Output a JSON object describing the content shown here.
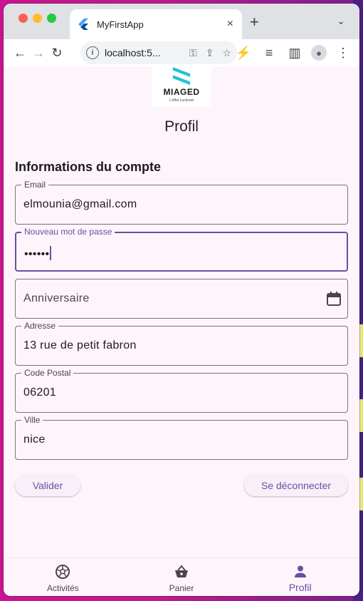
{
  "browser": {
    "tab_title": "MyFirstApp",
    "tab_close": "×",
    "new_tab": "+",
    "tab_menu": "⌄",
    "url": "localhost:5..."
  },
  "app": {
    "logo_text": "MIAGED",
    "logo_sub": "L'effet Lucknow",
    "page_title": "Profil",
    "section_title": "Informations du compte"
  },
  "form": {
    "email": {
      "label": "Email",
      "value": "elmounia@gmail.com"
    },
    "password": {
      "label": "Nouveau mot de passe",
      "value": "••••••"
    },
    "birthday": {
      "placeholder": "Anniversaire"
    },
    "address": {
      "label": "Adresse",
      "value": "13 rue de petit fabron"
    },
    "postal": {
      "label": "Code Postal",
      "value": "06201"
    },
    "city": {
      "label": "Ville",
      "value": "nice"
    }
  },
  "actions": {
    "validate": "Valider",
    "logout": "Se déconnecter"
  },
  "nav": {
    "items": [
      {
        "label": "Activités",
        "icon": "soccer-ball-icon"
      },
      {
        "label": "Panier",
        "icon": "basket-icon"
      },
      {
        "label": "Profil",
        "icon": "person-icon"
      }
    ],
    "active": "Profil"
  },
  "colors": {
    "accent": "#6750a4",
    "background": "#fdf5fb"
  }
}
